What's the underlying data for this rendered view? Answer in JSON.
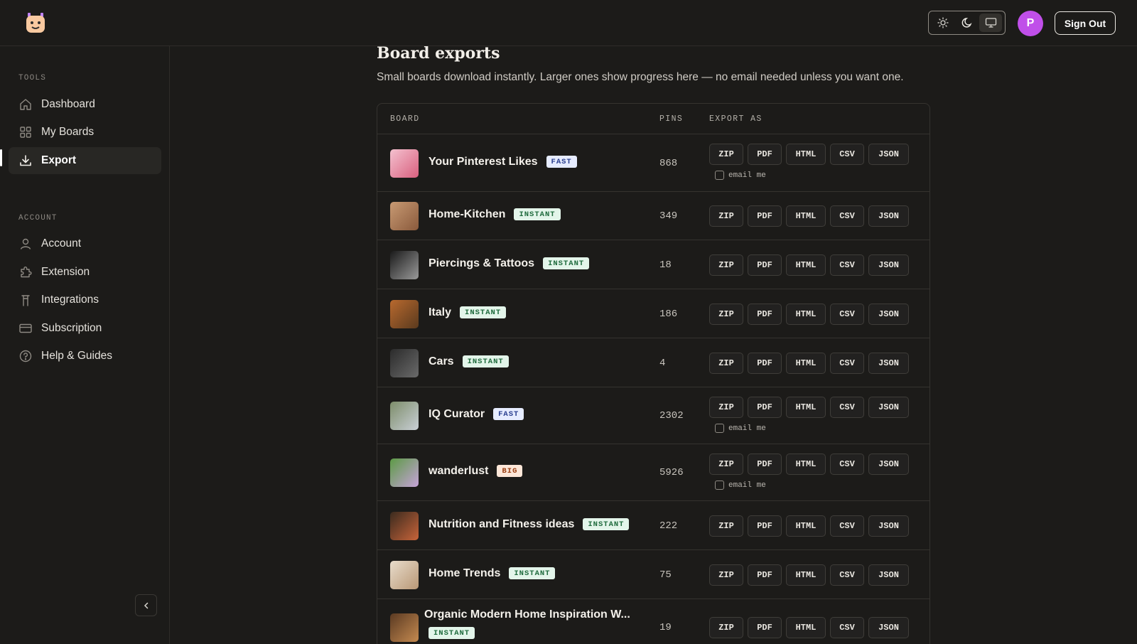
{
  "header": {
    "avatar_initial": "P",
    "sign_out_label": "Sign Out",
    "theme_options": [
      "light",
      "dark",
      "system"
    ]
  },
  "sidebar": {
    "tools_label": "TOOLS",
    "account_label": "ACCOUNT",
    "tools": [
      {
        "label": "Dashboard",
        "icon": "home-icon"
      },
      {
        "label": "My Boards",
        "icon": "grid-icon"
      },
      {
        "label": "Export",
        "icon": "download-icon",
        "active": true
      }
    ],
    "account": [
      {
        "label": "Account",
        "icon": "user-icon"
      },
      {
        "label": "Extension",
        "icon": "puzzle-icon"
      },
      {
        "label": "Integrations",
        "icon": "plug-icon"
      },
      {
        "label": "Subscription",
        "icon": "credit-card-icon"
      },
      {
        "label": "Help & Guides",
        "icon": "help-circle-icon"
      }
    ]
  },
  "page": {
    "title": "Board exports",
    "subtitle": "Small boards download instantly. Larger ones show progress here — no email needed unless you want one."
  },
  "table": {
    "headers": {
      "board": "BOARD",
      "pins": "PINS",
      "export_as": "EXPORT AS"
    },
    "formats": [
      "ZIP",
      "PDF",
      "HTML",
      "CSV",
      "JSON"
    ],
    "email_me_label": "email me",
    "rows": [
      {
        "name": "Your Pinterest Likes",
        "badge": "FAST",
        "pins": "868",
        "email_option": true
      },
      {
        "name": "Home-Kitchen",
        "badge": "INSTANT",
        "pins": "349",
        "email_option": false
      },
      {
        "name": "Piercings & Tattoos",
        "badge": "INSTANT",
        "pins": "18",
        "email_option": false
      },
      {
        "name": "Italy",
        "badge": "INSTANT",
        "pins": "186",
        "email_option": false
      },
      {
        "name": "Cars",
        "badge": "INSTANT",
        "pins": "4",
        "email_option": false
      },
      {
        "name": "IQ Curator",
        "badge": "FAST",
        "pins": "2302",
        "email_option": true
      },
      {
        "name": "wanderlust",
        "badge": "BIG",
        "pins": "5926",
        "email_option": true
      },
      {
        "name": "Nutrition and Fitness ideas",
        "badge": "INSTANT",
        "pins": "222",
        "email_option": false
      },
      {
        "name": "Home Trends",
        "badge": "INSTANT",
        "pins": "75",
        "email_option": false
      },
      {
        "name": "Organic Modern Home Inspiration W...",
        "badge": "INSTANT",
        "pins": "19",
        "email_option": false
      }
    ]
  },
  "colors": {
    "background": "#1c1b19",
    "badge_fast_bg": "#e6ecff",
    "badge_instant_bg": "#e3f5ea",
    "badge_big_bg": "#fde7d8",
    "avatar": "#c04fe9"
  }
}
